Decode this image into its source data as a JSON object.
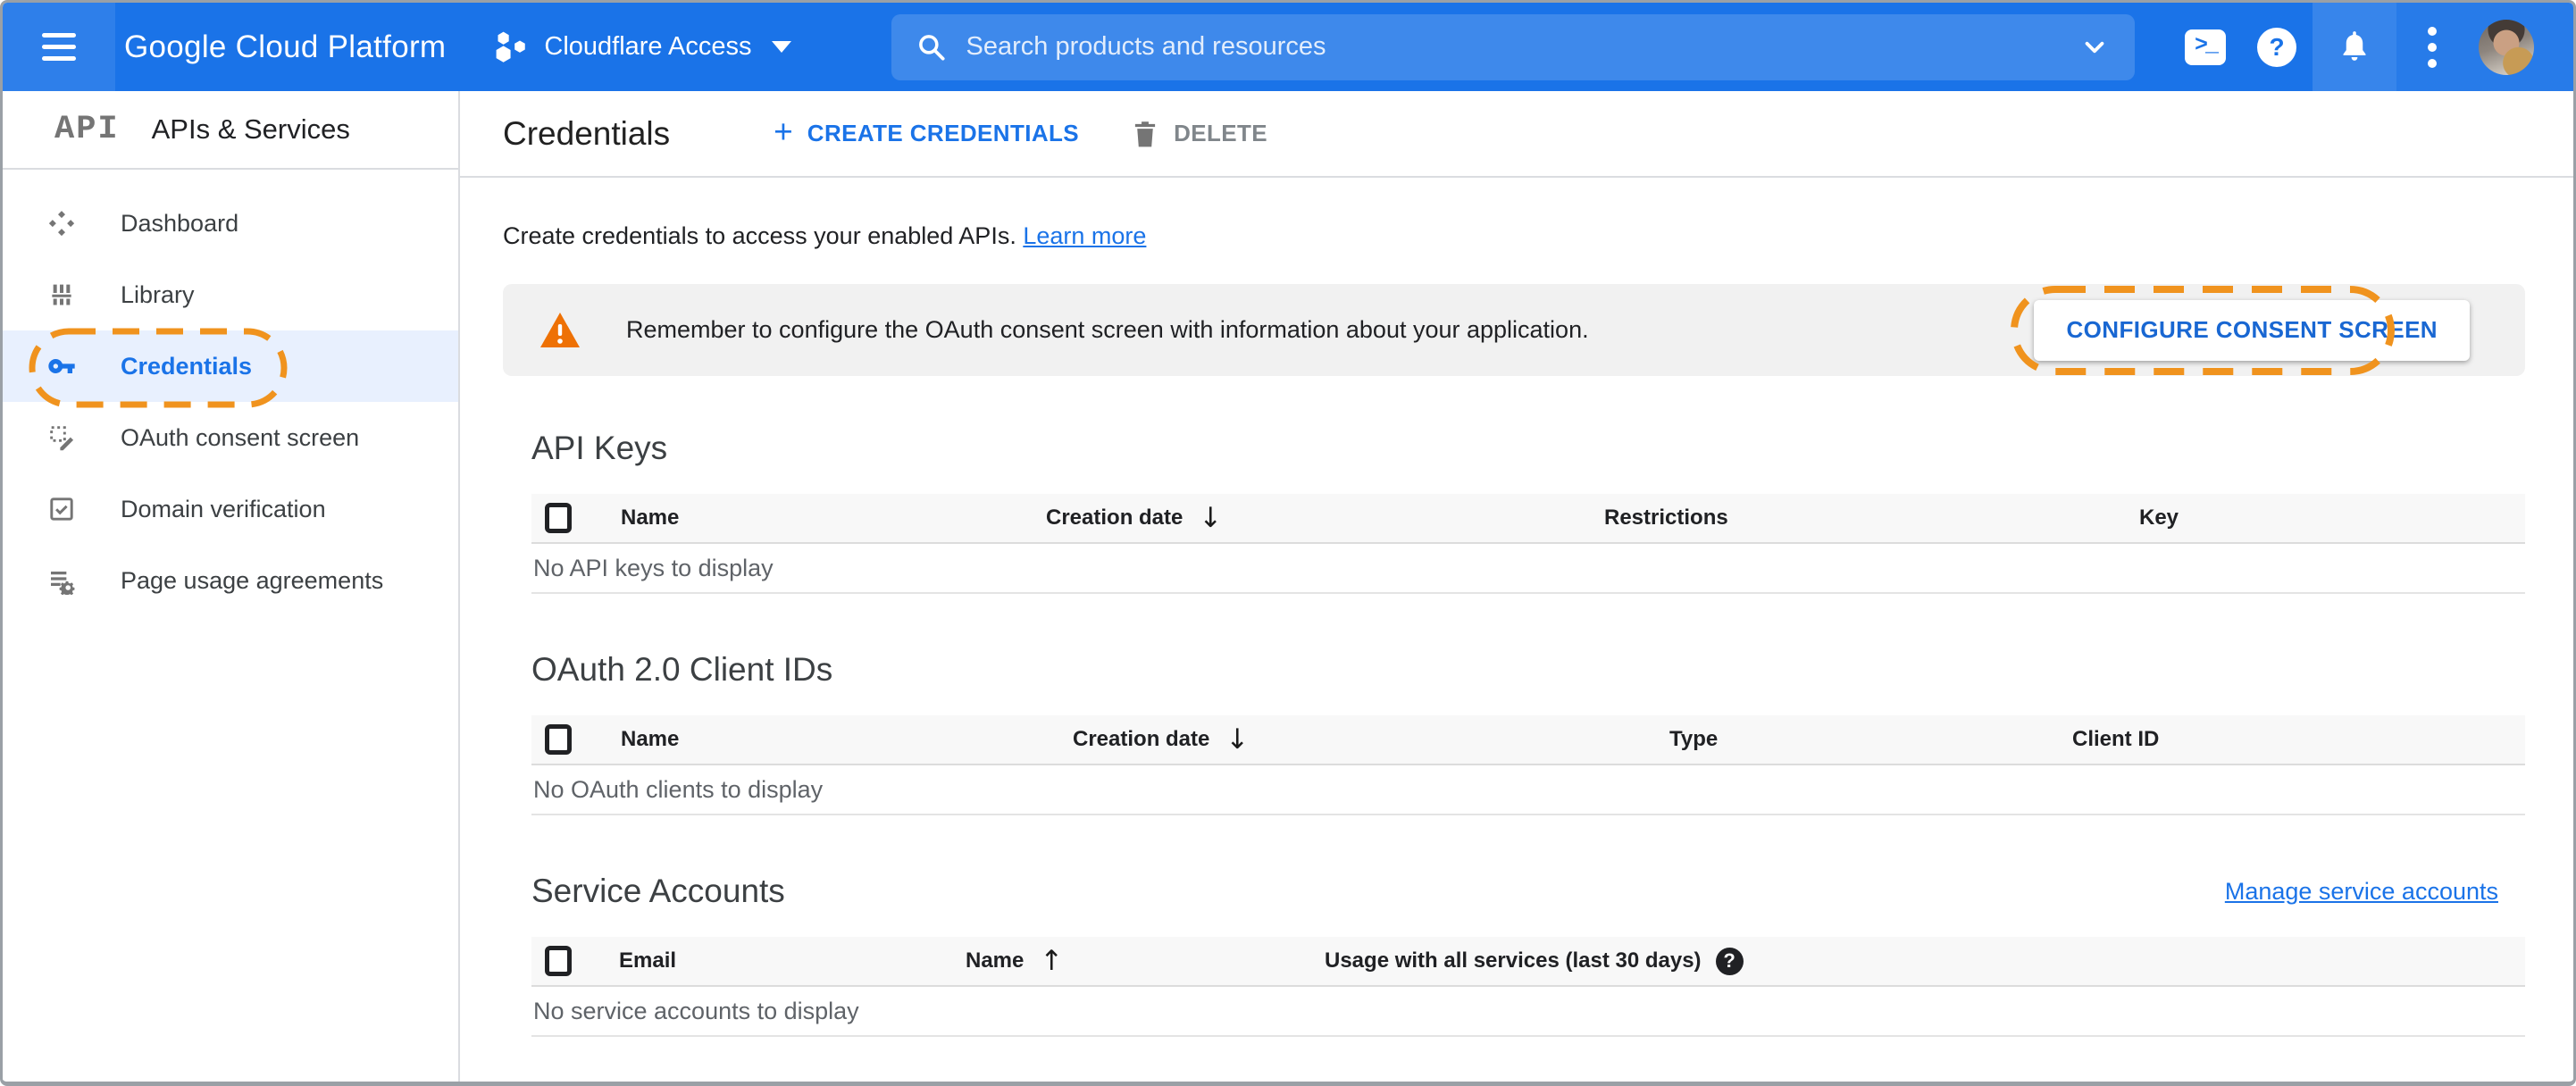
{
  "header": {
    "logo": "Google Cloud Platform",
    "project": "Cloudflare Access",
    "search_placeholder": "Search products and resources",
    "cloud_shell_glyph": ">_",
    "help_glyph": "?"
  },
  "sidebar": {
    "product_glyph": "API",
    "title": "APIs & Services",
    "items": [
      {
        "label": "Dashboard",
        "icon": "dashboard-icon",
        "active": false
      },
      {
        "label": "Library",
        "icon": "library-icon",
        "active": false
      },
      {
        "label": "Credentials",
        "icon": "key-icon",
        "active": true,
        "annotated": true
      },
      {
        "label": "OAuth consent screen",
        "icon": "consent-screen-icon",
        "active": false
      },
      {
        "label": "Domain verification",
        "icon": "domain-verification-icon",
        "active": false
      },
      {
        "label": "Page usage agreements",
        "icon": "page-usage-icon",
        "active": false
      }
    ]
  },
  "toolbar": {
    "title": "Credentials",
    "plus_glyph": "+",
    "create_label": "CREATE CREDENTIALS",
    "delete_label": "DELETE"
  },
  "intro": {
    "text": "Create credentials to access your enabled APIs.",
    "link_label": "Learn more"
  },
  "banner": {
    "message": "Remember to configure the OAuth consent screen with information about your application.",
    "button_label": "CONFIGURE CONSENT SCREEN"
  },
  "glyphs": {
    "sort_desc": "↓",
    "sort_asc": "↑",
    "help": "?"
  },
  "sections": {
    "api_keys": {
      "title": "API Keys",
      "columns": [
        "Name",
        "Creation date",
        "Restrictions",
        "Key"
      ],
      "sorted_by": "Creation date",
      "sort_direction": "descending",
      "empty": "No API keys to display"
    },
    "oauth_clients": {
      "title": "OAuth 2.0 Client IDs",
      "columns": [
        "Name",
        "Creation date",
        "Type",
        "Client ID"
      ],
      "sorted_by": "Creation date",
      "sort_direction": "descending",
      "empty": "No OAuth clients to display"
    },
    "service_accounts": {
      "title": "Service Accounts",
      "manage_link": "Manage service accounts",
      "columns": [
        "Email",
        "Name",
        "Usage with all services (last 30 days)"
      ],
      "sorted_by": "Name",
      "sort_direction": "ascending",
      "empty": "No service accounts to display"
    }
  },
  "colors": {
    "header_blue": "#1a73e8",
    "link_blue": "#1a73e8",
    "active_item_bg": "#e8f0fe",
    "annotation_orange": "#f0931e",
    "warning_orange": "#ee7105",
    "banner_bg": "#f1f1f1",
    "table_header_bg": "#f8f8f8"
  }
}
